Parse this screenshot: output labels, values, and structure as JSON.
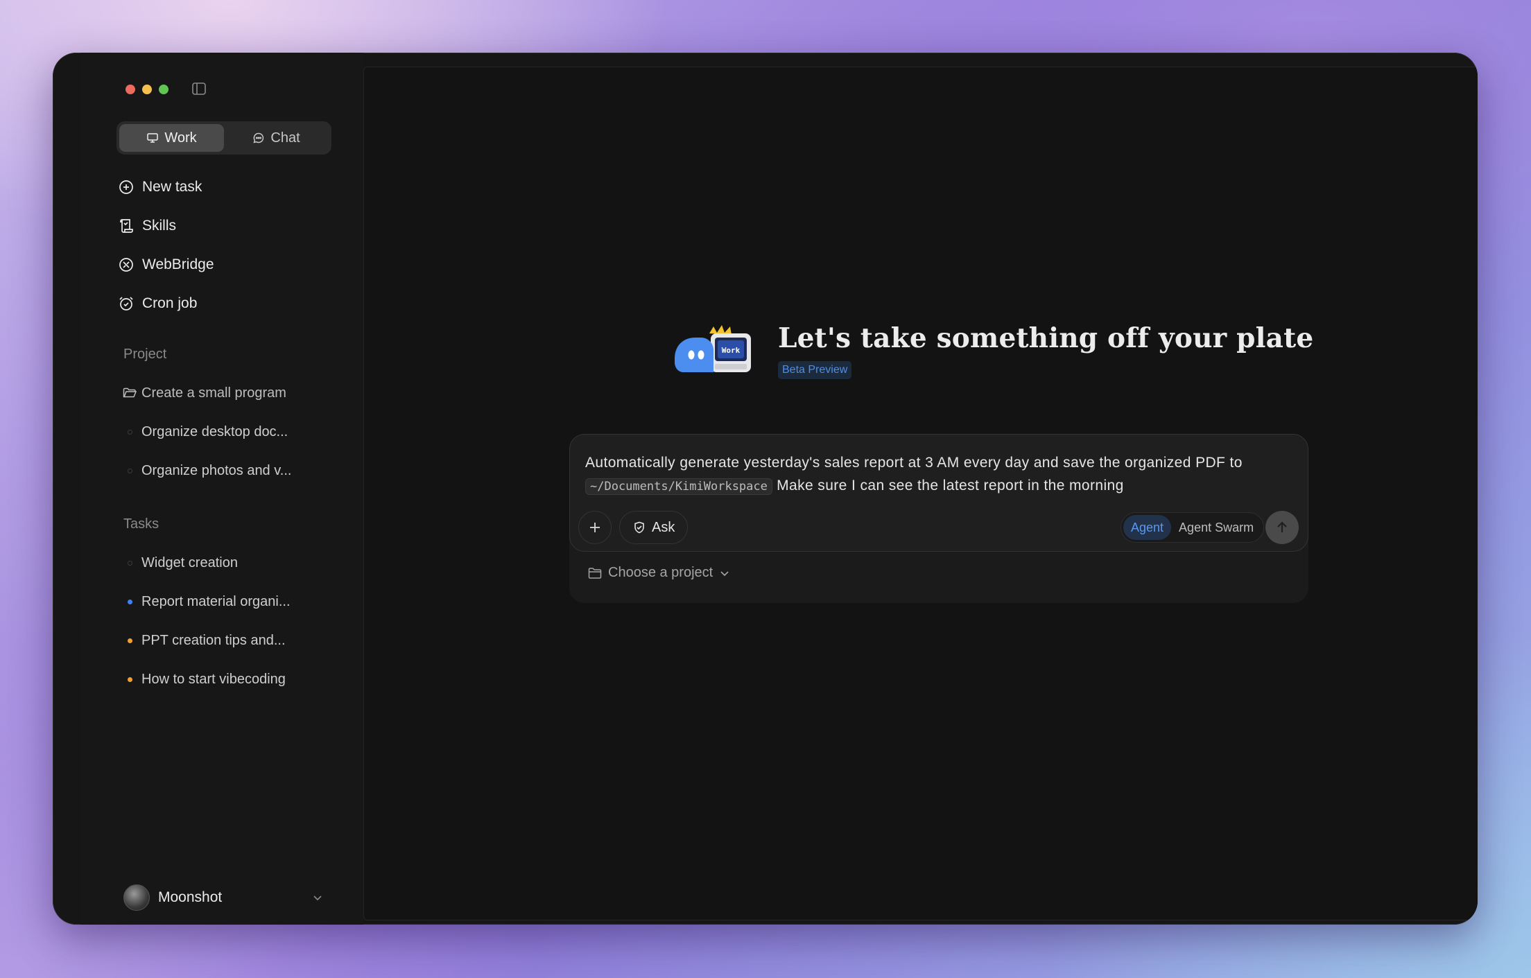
{
  "sidebar": {
    "mode_tabs": [
      {
        "label": "Work",
        "icon": "monitor-icon",
        "active": true
      },
      {
        "label": "Chat",
        "icon": "chat-bubble-icon",
        "active": false
      }
    ],
    "nav": [
      {
        "label": "New task",
        "icon": "plus-circle-icon"
      },
      {
        "label": "Skills",
        "icon": "scroll-icon"
      },
      {
        "label": "WebBridge",
        "icon": "bridge-icon"
      },
      {
        "label": "Cron job",
        "icon": "alarm-clock-icon"
      }
    ],
    "project_label": "Project",
    "projects": [
      {
        "label": "Create a small program",
        "icon": "folder-open-icon"
      },
      {
        "label": "Organize desktop doc...",
        "status": "empty"
      },
      {
        "label": "Organize photos and v...",
        "status": "empty"
      }
    ],
    "tasks_label": "Tasks",
    "tasks": [
      {
        "label": "Widget creation",
        "status": "empty"
      },
      {
        "label": "Report material organi...",
        "status": "running",
        "color": "#3b82f6"
      },
      {
        "label": "PPT creation tips and...",
        "status": "pending",
        "color": "#f0a030"
      },
      {
        "label": "How to start vibecoding",
        "status": "pending",
        "color": "#f0a030"
      }
    ],
    "user": {
      "name": "Moonshot"
    }
  },
  "main": {
    "mascot_badge": "Work",
    "title": "Let's take something off your plate",
    "badge": "Beta Preview",
    "prompt": {
      "text_before": "Automatically generate yesterday's sales report at 3 AM every day and save the organized PDF to",
      "path": "~/Documents/KimiWorkspace",
      "text_after": "Make sure I can see the latest report in the morning"
    },
    "ask_label": "Ask",
    "modes": [
      {
        "label": "Agent",
        "active": true
      },
      {
        "label": "Agent Swarm",
        "active": false
      }
    ],
    "project_picker": "Choose a project"
  },
  "colors": {
    "accent": "#4e8fe8",
    "running": "#3b82f6",
    "pending": "#f0a030"
  }
}
